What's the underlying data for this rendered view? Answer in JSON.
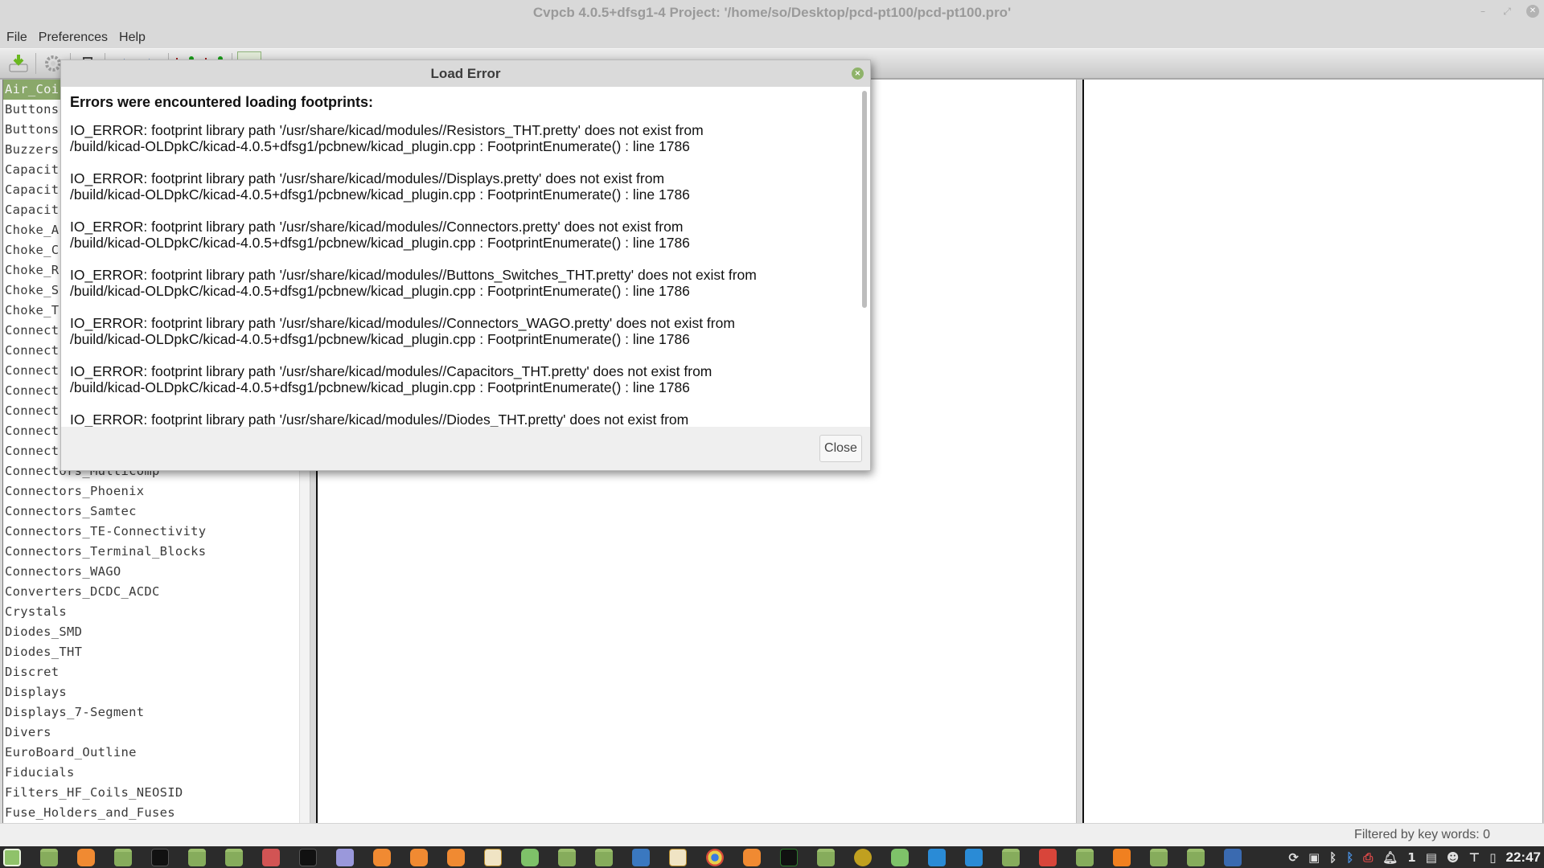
{
  "window": {
    "title": "Cvpcb 4.0.5+dfsg1-4  Project: '/home/so/Desktop/pcd-pt100/pcd-pt100.pro'",
    "controls": {
      "minimize": "–",
      "maximize": "⤢",
      "close": "✕"
    }
  },
  "menubar": {
    "items": [
      "File",
      "Preferences",
      "Help"
    ]
  },
  "toolbar": {
    "buttons": [
      {
        "icon": "save-icon"
      },
      {
        "icon": "settings-icon"
      },
      {
        "icon": "footprint-viewer-icon"
      },
      {
        "icon": "previous-icon"
      },
      {
        "icon": "next-icon"
      },
      {
        "icon": "auto-associate-icon"
      },
      {
        "icon": "delete-associations-icon"
      },
      {
        "icon": "filter-by-keyword-icon",
        "active": true
      },
      {
        "icon": "filter-by-pin-count-icon"
      },
      {
        "icon": "filter-by-library-icon"
      }
    ]
  },
  "library_list": {
    "items": [
      "Air_Coi",
      "Buttons",
      "Buttons",
      "Buzzers",
      "Capacit",
      "Capacit",
      "Capacit",
      "Choke_A",
      "Choke_C",
      "Choke_R",
      "Choke_S",
      "Choke_T",
      "Connect",
      "Connect",
      "Connect",
      "Connect",
      "Connect",
      "Connect",
      "Connect",
      "Connectors_Multicomp",
      "Connectors_Phoenix",
      "Connectors_Samtec",
      "Connectors_TE-Connectivity",
      "Connectors_Terminal_Blocks",
      "Connectors_WAGO",
      "Converters_DCDC_ACDC",
      "Crystals",
      "Diodes_SMD",
      "Diodes_THT",
      "Discret",
      "Displays",
      "Displays_7-Segment",
      "Divers",
      "EuroBoard_Outline",
      "Fiducials",
      "Filters_HF_Coils_NEOSID",
      "Fuse_Holders_and_Fuses"
    ],
    "selected_index": 0
  },
  "statusbar": {
    "text": "Filtered by key words: 0"
  },
  "dialog": {
    "title": "Load Error",
    "heading": "Errors were encountered loading footprints:",
    "errors": [
      {
        "line1": "IO_ERROR: footprint library path '/usr/share/kicad/modules//Resistors_THT.pretty' does not exist from",
        "line2": "/build/kicad-OLDpkC/kicad-4.0.5+dfsg1/pcbnew/kicad_plugin.cpp : FootprintEnumerate() : line 1786"
      },
      {
        "line1": "IO_ERROR: footprint library path '/usr/share/kicad/modules//Displays.pretty' does not exist from",
        "line2": "/build/kicad-OLDpkC/kicad-4.0.5+dfsg1/pcbnew/kicad_plugin.cpp : FootprintEnumerate() : line 1786"
      },
      {
        "line1": "IO_ERROR: footprint library path '/usr/share/kicad/modules//Connectors.pretty' does not exist from",
        "line2": "/build/kicad-OLDpkC/kicad-4.0.5+dfsg1/pcbnew/kicad_plugin.cpp : FootprintEnumerate() : line 1786"
      },
      {
        "line1": "IO_ERROR: footprint library path '/usr/share/kicad/modules//Buttons_Switches_THT.pretty' does not exist from",
        "line2": "/build/kicad-OLDpkC/kicad-4.0.5+dfsg1/pcbnew/kicad_plugin.cpp : FootprintEnumerate() : line 1786"
      },
      {
        "line1": "IO_ERROR: footprint library path '/usr/share/kicad/modules//Connectors_WAGO.pretty' does not exist from",
        "line2": "/build/kicad-OLDpkC/kicad-4.0.5+dfsg1/pcbnew/kicad_plugin.cpp : FootprintEnumerate() : line 1786"
      },
      {
        "line1": "IO_ERROR: footprint library path '/usr/share/kicad/modules//Capacitors_THT.pretty' does not exist from",
        "line2": "/build/kicad-OLDpkC/kicad-4.0.5+dfsg1/pcbnew/kicad_plugin.cpp : FootprintEnumerate() : line 1786"
      },
      {
        "line1": "IO_ERROR: footprint library path '/usr/share/kicad/modules//Diodes_THT.pretty' does not exist from",
        "line2": ""
      }
    ],
    "close_button": "Close",
    "close_icon": "×"
  },
  "taskbar": {
    "launchers": [
      "mint-menu-icon",
      "show-desktop-icon",
      "firefox-icon",
      "folder-icon",
      "terminal-icon",
      "folder-icon",
      "folder-icon",
      "glasses-app-icon",
      "terminal-icon",
      "text-editor-icon",
      "firefox-icon",
      "firefox-icon",
      "firefox-icon",
      "kicad-icon",
      "calculator-icon",
      "folder-icon",
      "folder-icon",
      "download-manager-icon",
      "kicad-icon",
      "chrome-icon",
      "firefox-icon",
      "system-monitor-icon",
      "folder-icon",
      "matlab-icon",
      "upload-app-icon",
      "document-icon",
      "document-icon",
      "folder-icon",
      "gimp-icon",
      "folder-icon",
      "media-player-icon",
      "folder-icon",
      "folder-icon",
      "virtualbox-icon"
    ],
    "tray": {
      "icons": [
        "qgis-icon",
        "update-icon",
        "image-icon",
        "bluetooth-icon",
        "bluetooth-active-icon",
        "printer-error-icon",
        "notifications-icon",
        "workspace-icon",
        "user-icon",
        "network-icon",
        "battery-icon"
      ],
      "notification_count": "1",
      "clock": "22:47"
    }
  }
}
